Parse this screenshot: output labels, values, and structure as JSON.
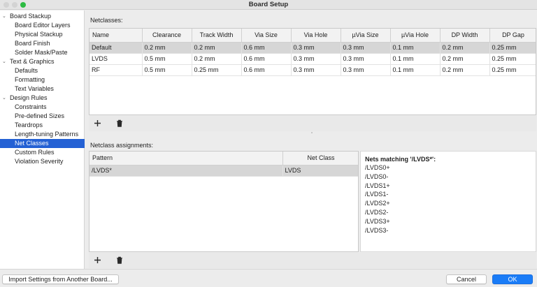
{
  "window": {
    "title": "Board Setup",
    "accent": "#2461d4",
    "ok_color": "#1a7cf7",
    "maximize_color": "#2dbb43"
  },
  "sidebar": {
    "items": [
      {
        "label": "Board Stackup",
        "level": 0,
        "arrow": "⌄"
      },
      {
        "label": "Board Editor Layers",
        "level": 1
      },
      {
        "label": "Physical Stackup",
        "level": 1
      },
      {
        "label": "Board Finish",
        "level": 1
      },
      {
        "label": "Solder Mask/Paste",
        "level": 1
      },
      {
        "label": "Text & Graphics",
        "level": 0,
        "arrow": "⌄"
      },
      {
        "label": "Defaults",
        "level": 1
      },
      {
        "label": "Formatting",
        "level": 1
      },
      {
        "label": "Text Variables",
        "level": 1
      },
      {
        "label": "Design Rules",
        "level": 0,
        "arrow": "⌄"
      },
      {
        "label": "Constraints",
        "level": 1
      },
      {
        "label": "Pre-defined Sizes",
        "level": 1
      },
      {
        "label": "Teardrops",
        "level": 1
      },
      {
        "label": "Length-tuning Patterns",
        "level": 1
      },
      {
        "label": "Net Classes",
        "level": 1,
        "selected": true
      },
      {
        "label": "Custom Rules",
        "level": 1
      },
      {
        "label": "Violation Severity",
        "level": 1
      }
    ]
  },
  "netclasses": {
    "section_label": "Netclasses:",
    "columns": [
      "Name",
      "Clearance",
      "Track Width",
      "Via Size",
      "Via Hole",
      "µVia Size",
      "µVia Hole",
      "DP Width",
      "DP Gap"
    ],
    "rows": [
      [
        "Default",
        "0.2 mm",
        "0.2 mm",
        "0.6 mm",
        "0.3 mm",
        "0.3 mm",
        "0.1 mm",
        "0.2 mm",
        "0.25 mm"
      ],
      [
        "LVDS",
        "0.5 mm",
        "0.2 mm",
        "0.6 mm",
        "0.3 mm",
        "0.3 mm",
        "0.1 mm",
        "0.2 mm",
        "0.25 mm"
      ],
      [
        "RF",
        "0.5 mm",
        "0.25 mm",
        "0.6 mm",
        "0.3 mm",
        "0.3 mm",
        "0.1 mm",
        "0.2 mm",
        "0.25 mm"
      ]
    ],
    "selected_row": 0,
    "add_icon": "plus-icon",
    "delete_icon": "trash-icon"
  },
  "assignments": {
    "section_label": "Netclass assignments:",
    "columns": [
      "Pattern",
      "Net Class"
    ],
    "rows": [
      [
        "/LVDS*",
        "LVDS"
      ]
    ],
    "selected_row": 0
  },
  "nets_panel": {
    "title": "Nets matching '/LVDS*':",
    "nets": [
      "/LVDS0+",
      "/LVDS0-",
      "/LVDS1+",
      "/LVDS1-",
      "/LVDS2+",
      "/LVDS2-",
      "/LVDS3+",
      "/LVDS3-"
    ]
  },
  "footer": {
    "import_label": "Import Settings from Another Board...",
    "cancel_label": "Cancel",
    "ok_label": "OK"
  }
}
